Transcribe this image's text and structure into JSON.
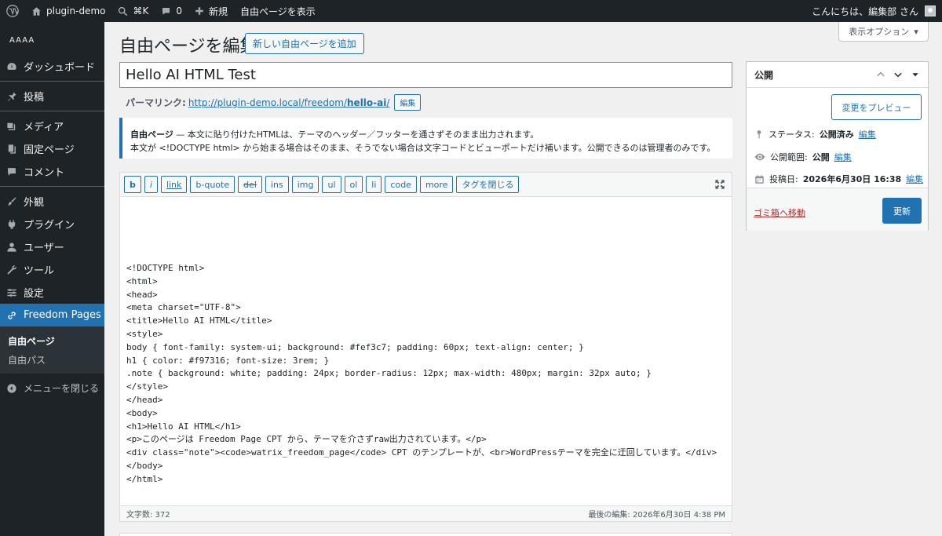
{
  "adminbar": {
    "site_name": "plugin-demo",
    "shortcut": "⌘K",
    "comments_count": "0",
    "new_label": "新規",
    "view_label": "自由ページを表示",
    "greeting": "こんにちは、編集部 さん"
  },
  "sidebar": {
    "site_label": "AAAA",
    "items": [
      {
        "label": "ダッシュボード",
        "icon": "dashboard-icon"
      },
      {
        "label": "投稿",
        "icon": "pin-icon"
      },
      {
        "label": "メディア",
        "icon": "media-icon"
      },
      {
        "label": "固定ページ",
        "icon": "page-icon"
      },
      {
        "label": "コメント",
        "icon": "comment-icon"
      },
      {
        "label": "外観",
        "icon": "brush-icon"
      },
      {
        "label": "プラグイン",
        "icon": "plugin-icon"
      },
      {
        "label": "ユーザー",
        "icon": "user-icon"
      },
      {
        "label": "ツール",
        "icon": "wrench-icon"
      },
      {
        "label": "設定",
        "icon": "settings-icon"
      },
      {
        "label": "Freedom Pages",
        "icon": "link-icon"
      }
    ],
    "submenu": [
      "自由ページ",
      "自由パス"
    ],
    "collapse_label": "メニューを閉じる"
  },
  "header": {
    "title": "自由ページを編集",
    "add_new": "新しい自由ページを追加",
    "screen_options": "表示オプション"
  },
  "post": {
    "title": "Hello AI HTML Test",
    "permalink_label": "パーマリンク:",
    "permalink_base": "http://plugin-demo.local/freedom/",
    "permalink_slug": "hello-ai",
    "permalink_edit": "編集"
  },
  "notice": {
    "strong": "自由ページ",
    "line1": " — 本文に貼り付けたHTMLは、テーマのヘッダー／フッターを通さずそのまま出力されます。",
    "line2": "本文が <!DOCTYPE html> から始まる場合はそのまま、そうでない場合は文字コードとビューポートだけ補います。公開できるのは管理者のみです。"
  },
  "toolbar": {
    "buttons": [
      "b",
      "i",
      "link",
      "b-quote",
      "del",
      "ins",
      "img",
      "ul",
      "ol",
      "li",
      "code",
      "more",
      "タグを閉じる"
    ]
  },
  "editor": {
    "content": "<!DOCTYPE html>\n<html>\n<head>\n<meta charset=\"UTF-8\">\n<title>Hello AI HTML</title>\n<style>\nbody { font-family: system-ui; background: #fef3c7; padding: 60px; text-align: center; }\nh1 { color: #f97316; font-size: 3rem; }\n.note { background: white; padding: 24px; border-radius: 12px; max-width: 480px; margin: 32px auto; }\n</style>\n</head>\n<body>\n<h1>Hello AI HTML</h1>\n<p>このページは Freedom Page CPT から、テーマを介さずraw出力されています。</p>\n<div class=\"note\"><code>watrix_freedom_page</code> CPT のテンプレートが、<br>WordPressテーマを完全に迂回しています。</div>\n</body>\n</html>",
    "word_count": "文字数: 372",
    "last_edited": "最後の編集: 2026年6月30日 4:38 PM"
  },
  "publish": {
    "title": "公開",
    "preview": "変更をプレビュー",
    "status_label": "ステータス:",
    "status_value": "公開済み",
    "visibility_label": "公開範囲:",
    "visibility_value": "公開",
    "date_label": "投稿日:",
    "date_value": "2026年6月30日 16:38",
    "edit": "編集",
    "trash": "ゴミ箱へ移動",
    "update": "更新"
  },
  "colors": {
    "admin_dark": "#1d2327",
    "accent": "#2271b1",
    "danger": "#d63638"
  }
}
